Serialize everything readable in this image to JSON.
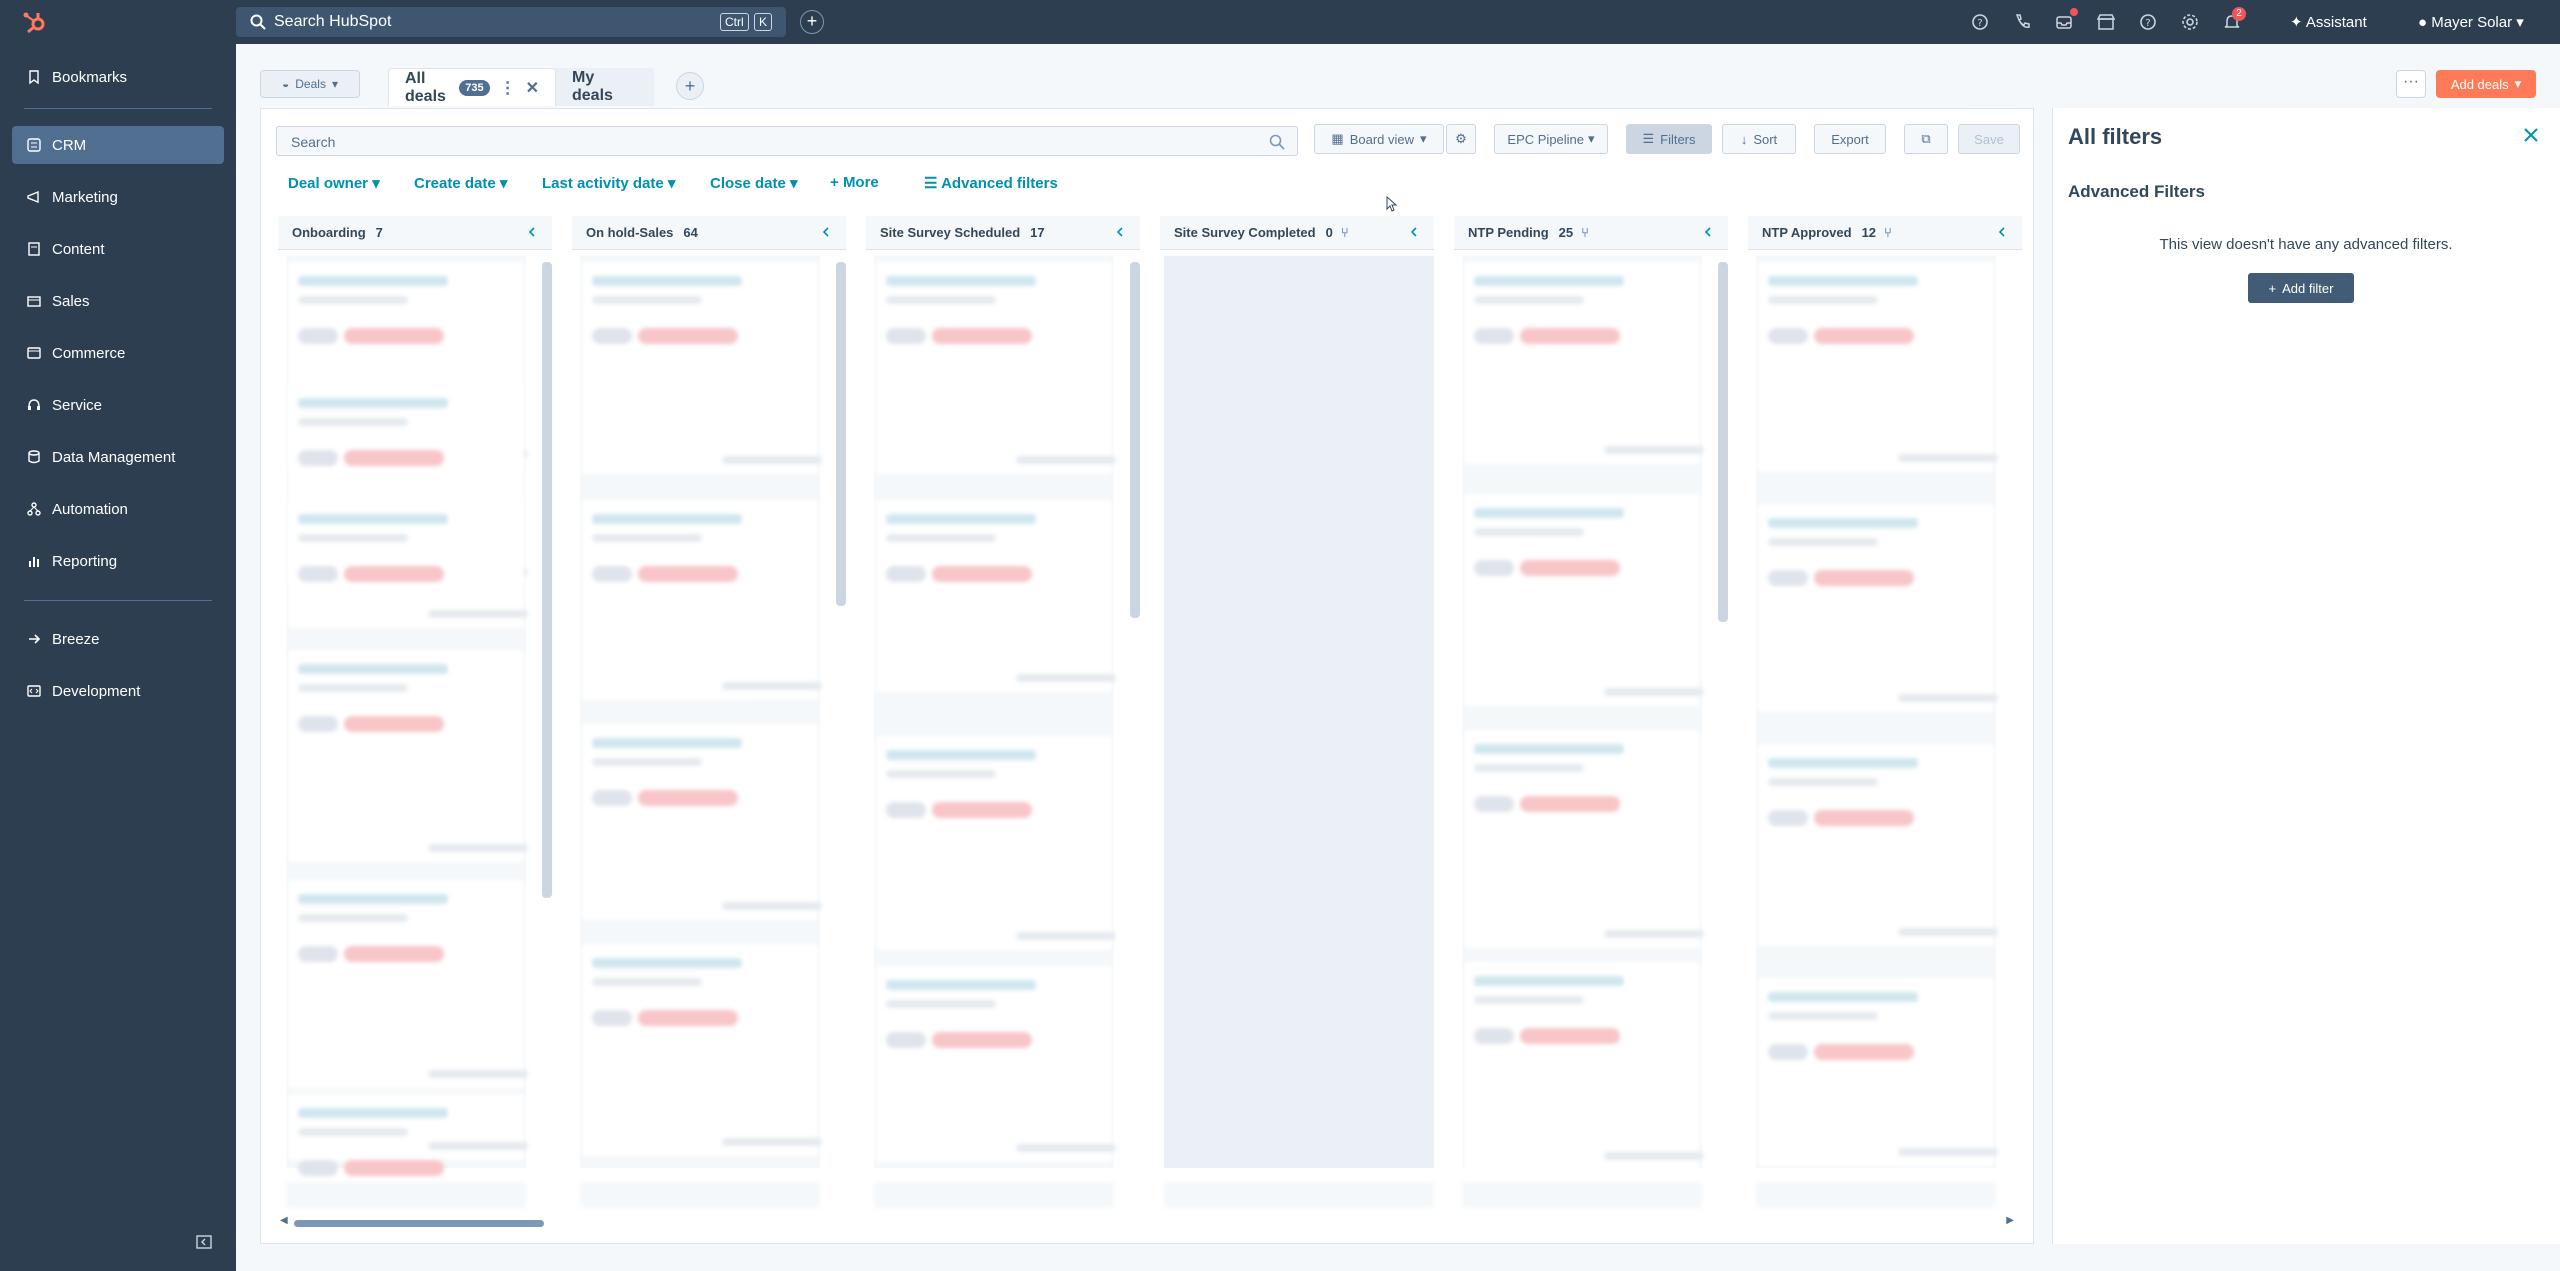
{
  "topbar": {
    "search_placeholder": "Search HubSpot",
    "kbd_ctrl": "Ctrl",
    "kbd_k": "K",
    "add_label": "+",
    "assistant_label": "Assistant",
    "account_label": "Mayer Solar",
    "notification_count": "2"
  },
  "sidebar": {
    "items": [
      {
        "label": "Bookmarks",
        "icon": "bookmark-icon"
      },
      {
        "label": "CRM",
        "icon": "crm-icon"
      },
      {
        "label": "Marketing",
        "icon": "marketing-icon"
      },
      {
        "label": "Content",
        "icon": "content-icon"
      },
      {
        "label": "Sales",
        "icon": "sales-icon"
      },
      {
        "label": "Commerce",
        "icon": "commerce-icon"
      },
      {
        "label": "Service",
        "icon": "service-icon"
      },
      {
        "label": "Data Management",
        "icon": "data-icon"
      },
      {
        "label": "Automation",
        "icon": "automation-icon"
      },
      {
        "label": "Reporting",
        "icon": "reporting-icon"
      },
      {
        "label": "Breeze",
        "icon": "breeze-icon"
      },
      {
        "label": "Development",
        "icon": "development-icon"
      }
    ]
  },
  "header": {
    "object_selector": "Deals",
    "tabs": [
      {
        "label": "All deals",
        "count": "735"
      },
      {
        "label": "My deals"
      }
    ],
    "more_label": "···",
    "add_deals_label": "Add deals"
  },
  "toolbar": {
    "search_placeholder": "Search",
    "board_view_label": "Board view",
    "pipeline_label": "EPC Pipeline",
    "filters_label": "Filters",
    "sort_label": "Sort",
    "export_label": "Export",
    "save_label": "Save"
  },
  "filters_row": {
    "deal_owner": "Deal owner",
    "create_date": "Create date",
    "last_activity_date": "Last activity date",
    "close_date": "Close date",
    "more": "More",
    "advanced": "Advanced filters"
  },
  "columns": [
    {
      "name": "Onboarding",
      "count": "7"
    },
    {
      "name": "On hold-Sales",
      "count": "64"
    },
    {
      "name": "Site Survey Scheduled",
      "count": "17"
    },
    {
      "name": "Site Survey Completed",
      "count": "0"
    },
    {
      "name": "NTP Pending",
      "count": "25"
    },
    {
      "name": "NTP Approved",
      "count": "12"
    }
  ],
  "filters_panel": {
    "title": "All filters",
    "subtitle": "Advanced Filters",
    "empty_text": "This view doesn't have any advanced filters.",
    "add_filter_label": "Add filter"
  },
  "colors": {
    "nav_bg": "#2d3e50",
    "accent": "#ff7a59",
    "link": "#0091ae"
  }
}
